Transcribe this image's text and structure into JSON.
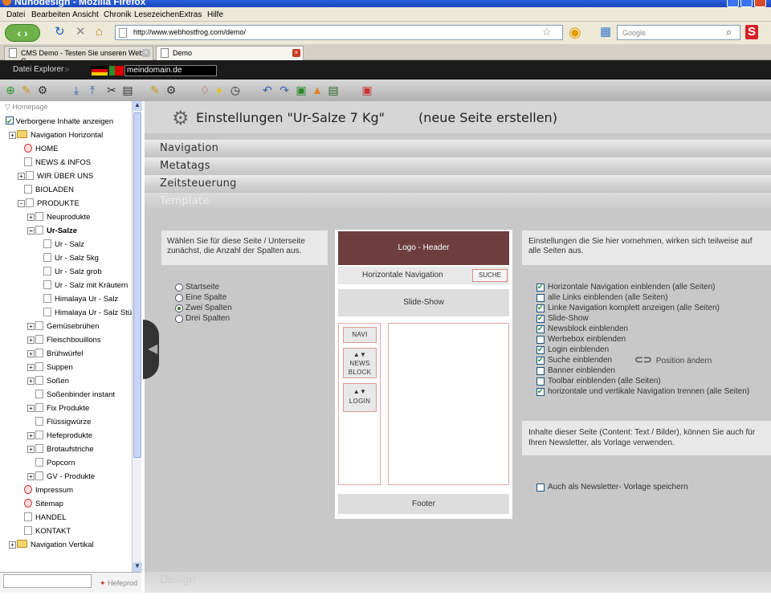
{
  "window": {
    "title": "Nuhodesign - Mozilla Firefox"
  },
  "menu": [
    "Datei",
    "Bearbeiten",
    "Ansicht",
    "Chronik",
    "Lesezeichen",
    "Extras",
    "Hilfe"
  ],
  "url": "http://www.webhostfrog.com/demo/",
  "search_placeholder": "Google",
  "tabs": [
    {
      "label": "CMS Demo - Testen Sie unseren Web C..."
    },
    {
      "label": "Demo"
    }
  ],
  "appbar": {
    "explorer": "Datei Explorer",
    "domain": "meindomain.de"
  },
  "sidebar": {
    "home_link": "Homepage",
    "show_hidden": "Verborgene Inhalte anzeigen",
    "items": [
      {
        "label": "Navigation Horizontal"
      },
      {
        "label": "HOME"
      },
      {
        "label": "NEWS & INFOS"
      },
      {
        "label": "WIR ÜBER UNS"
      },
      {
        "label": "BIOLADEN"
      },
      {
        "label": "PRODUKTE"
      },
      {
        "label": "Neuprodukte"
      },
      {
        "label": "Ur-Salze"
      },
      {
        "label": "Ur - Salz"
      },
      {
        "label": "Ur - Salz 5kg"
      },
      {
        "label": "Ur - Salz grob"
      },
      {
        "label": "Ur - Salz mit Kräutern"
      },
      {
        "label": "Himalaya Ur - Salz"
      },
      {
        "label": "Himalaya Ur - Salz Stü"
      },
      {
        "label": "Gemüsebrühen"
      },
      {
        "label": "Fleischbouillons"
      },
      {
        "label": "Brühwürfel"
      },
      {
        "label": "Suppen"
      },
      {
        "label": "Soßen"
      },
      {
        "label": "Soßenbinder instant"
      },
      {
        "label": "Fix Produkte"
      },
      {
        "label": "Flüssigwürze"
      },
      {
        "label": "Hefeprodukte"
      },
      {
        "label": "Brotaufstriche"
      },
      {
        "label": "Popcorn"
      },
      {
        "label": "GV - Produkte"
      },
      {
        "label": "Impressum"
      },
      {
        "label": "Sitemap"
      },
      {
        "label": "HANDEL"
      },
      {
        "label": "KONTAKT"
      },
      {
        "label": "Navigation Vertikal"
      }
    ],
    "bottom_hint": "Hefeprod"
  },
  "main": {
    "title": "Einstellungen \"Ur-Salze 7 Kg\"",
    "subtitle": "(neue Seite erstellen)",
    "sections": [
      "Navigation",
      "Metatags",
      "Zeitsteuerung",
      "Template"
    ],
    "design_section": "Design",
    "columns_hint": "Wählen Sie für diese Seite / Unterseite zunächst, die Anzahl der Spalten aus.",
    "radios": [
      {
        "label": "Startseite",
        "checked": false
      },
      {
        "label": "Eine Spalte",
        "checked": false
      },
      {
        "label": "Zwei Spalten",
        "checked": true
      },
      {
        "label": "Drei Spalten",
        "checked": false
      }
    ],
    "layout": {
      "logo": "Logo - Header",
      "hnav": "Horizontale Navigation",
      "search": "SUCHE",
      "slideshow": "Slide-Show",
      "navi": "NAVI",
      "news_arrows": "▲▼",
      "news": "NEWS",
      "block": "BLOCK",
      "login_arrows": "▲▼",
      "login": "LOGIN",
      "footer": "Footer"
    },
    "settings_hint": "Einstellungen die Sie hier vornehmen, wirken sich teilweise auf alle Seiten aus.",
    "options": [
      {
        "label": "Horizontale Navigation einblenden (alle Seiten)",
        "checked": true
      },
      {
        "label": "alle Links einblenden (alle Seiten)",
        "checked": false
      },
      {
        "label": "Linke Navigation komplett anzeigen (alle Seiten)",
        "checked": true
      },
      {
        "label": "Slide-Show",
        "checked": true
      },
      {
        "label": "Newsblock einblenden",
        "checked": true
      },
      {
        "label": "Werbebox einblenden",
        "checked": false
      },
      {
        "label": "Login einblenden",
        "checked": true
      },
      {
        "label": "Suche einblenden",
        "checked": true
      },
      {
        "label": "Banner einblenden",
        "checked": false
      },
      {
        "label": "Toolbar einblenden (alle Seiten)",
        "checked": false
      },
      {
        "label": "horizontale und vertikale Navigation trennen (alle Seiten)",
        "checked": true
      }
    ],
    "position_change": "Position ändern",
    "newsletter_hint": "Inhalte dieser Seite (Content: Text / Bilder), können Sie auch für Ihren Newsletter, als Vorlage verwenden.",
    "newsletter_option": "Auch als Newsletter- Vorlage speichern"
  }
}
